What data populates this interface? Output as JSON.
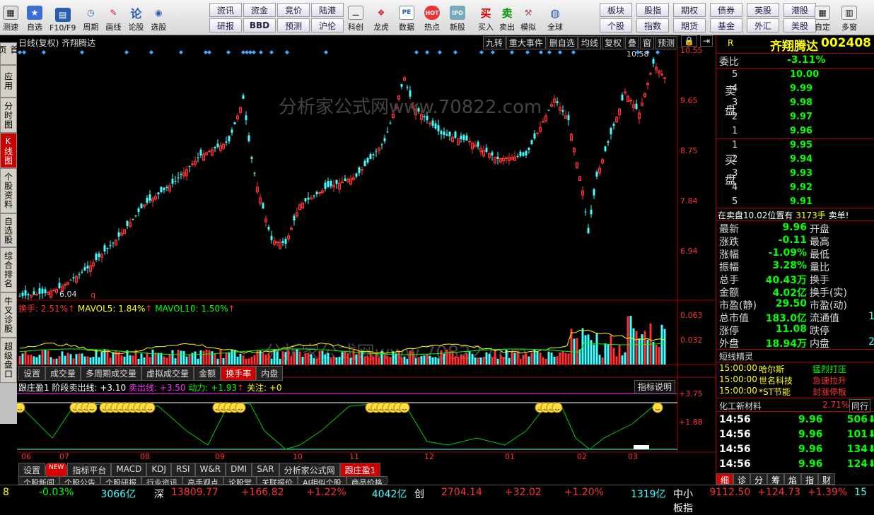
{
  "toolbar": {
    "buttons": [
      {
        "label": "测速",
        "icon": "speed-icon"
      },
      {
        "label": "自选",
        "icon": "star-icon"
      },
      {
        "label": "F10/F9",
        "icon": "f10-icon"
      },
      {
        "label": "周期",
        "icon": "clock-icon"
      },
      {
        "label": "画线",
        "icon": "pen-icon"
      },
      {
        "label": "论股",
        "icon": "discuss-icon"
      },
      {
        "label": "选股",
        "icon": "select-icon"
      }
    ],
    "grid1": [
      "资讯",
      "资金",
      "竞价",
      "陆港",
      "研报",
      "BBD",
      "预测",
      "沪伦"
    ],
    "buttons2": [
      {
        "label": "科创",
        "icon": "chart-icon"
      },
      {
        "label": "龙虎",
        "icon": "dragon-icon"
      },
      {
        "label": "数据",
        "icon": "pe-icon"
      },
      {
        "label": "热点",
        "icon": "hot-icon"
      },
      {
        "label": "新股",
        "icon": "ipo-icon"
      },
      {
        "label": "买入",
        "icon": "buy-icon"
      },
      {
        "label": "卖出",
        "icon": "sell-icon"
      },
      {
        "label": "模拟",
        "icon": "hammer-icon"
      },
      {
        "label": "全球",
        "icon": "globe-icon"
      }
    ],
    "grid2": [
      "板块",
      "股指",
      "期权",
      "债券",
      "英股",
      "港股",
      "个股",
      "指数",
      "期货",
      "基金",
      "外汇",
      "美股"
    ],
    "buttons3": [
      {
        "label": "自定",
        "icon": "custom-icon"
      },
      {
        "label": "多窗",
        "icon": "window-icon"
      }
    ],
    "buy_glyph": "买",
    "sell_glyph": "卖"
  },
  "left_nav": [
    {
      "label": "首页",
      "active": false
    },
    {
      "label": "应用",
      "active": false
    },
    {
      "label": "分时图",
      "active": false
    },
    {
      "label": "K线图",
      "active": true
    },
    {
      "label": "个股资料",
      "active": false
    },
    {
      "label": "自选股",
      "active": false
    },
    {
      "label": "综合排名",
      "active": false
    },
    {
      "label": "牛叉诊股",
      "active": false
    },
    {
      "label": "超级盘口",
      "active": false
    }
  ],
  "chart": {
    "title": "日线(复权) 齐翔腾达",
    "top_buttons": [
      "九转",
      "重大事件",
      "删自选",
      "均线",
      "复权",
      "叠",
      "窗",
      "预测"
    ],
    "watermark": "分析家公式网www.70822.com",
    "price_axis": [
      "10.55",
      "9.65",
      "8.75",
      "7.84",
      "6.94"
    ],
    "high_label": "10.58",
    "low_label": "6.04",
    "q_label": "q",
    "volume_header": {
      "a": "换手: 2.51%",
      "b": "MAVOL5: 1.84%",
      "c": "MAVOL10: 1.50%",
      "arrow": "↑"
    },
    "volume_axis": [
      "0.063",
      "0.032"
    ],
    "volume_tabs": [
      "设置",
      "成交量",
      "多周期成交量",
      "虚拟成交量",
      "金额",
      "换手率",
      "内盘"
    ],
    "volume_active_tab": "换手率",
    "indicator_header": {
      "name": "跟庄盈1",
      "a": "阶段卖出线: +3.10",
      "b": "卖出线: +3.50",
      "c": "动力: +1.93",
      "d": "关注: +0"
    },
    "indicator_btn": "指标说明",
    "indicator_axis": [
      "+3.75",
      "+1.88"
    ],
    "dates": [
      "06",
      "07",
      "08",
      "09",
      "10",
      "11",
      "12",
      "01",
      "02",
      "03"
    ],
    "indicator_tabs": [
      "设置",
      "NEW",
      "指标平台",
      "MACD",
      "KDJ",
      "RSI",
      "W&R",
      "DMI",
      "SAR",
      "分析家公式网",
      "跟庄盈1"
    ],
    "indicator_active_tab": "跟庄盈1",
    "news_tabs": [
      "个股新闻",
      "个股公告",
      "个股研报",
      "行业资讯",
      "高手观点",
      "论股堂",
      "关联报价",
      "AI相似个股",
      "商品价格"
    ]
  },
  "quote": {
    "r": "R",
    "name": "齐翔腾达",
    "code": "002408",
    "weibi_label": "委比",
    "weibi": "-3.11%",
    "sell_label": "卖盘",
    "buy_label": "买盘",
    "sells": [
      {
        "n": "5",
        "p": "10.00"
      },
      {
        "n": "4",
        "p": "9.99"
      },
      {
        "n": "3",
        "p": "9.98"
      },
      {
        "n": "2",
        "p": "9.97"
      },
      {
        "n": "1",
        "p": "9.96"
      }
    ],
    "buys": [
      {
        "n": "1",
        "p": "9.95"
      },
      {
        "n": "2",
        "p": "9.94"
      },
      {
        "n": "3",
        "p": "9.93"
      },
      {
        "n": "4",
        "p": "9.92"
      },
      {
        "n": "5",
        "p": "9.91"
      }
    ],
    "notice_a": "在卖盘10.02位置有",
    "notice_b": "3173手",
    "notice_c": "卖单!",
    "stats": [
      {
        "k": "最新",
        "v": "9.96",
        "k2": "开盘",
        "v2": ""
      },
      {
        "k": "涨跌",
        "v": "-0.11",
        "k2": "最高",
        "v2": ""
      },
      {
        "k": "涨幅",
        "v": "-1.09%",
        "k2": "最低",
        "v2": ""
      },
      {
        "k": "振幅",
        "v": "3.28%",
        "k2": "量比",
        "v2": ""
      },
      {
        "k": "总手",
        "v": "40.43万",
        "k2": "换手",
        "v2": ""
      },
      {
        "k": "金额",
        "v": "4.02亿",
        "k2": "换手(实)",
        "v2": ""
      },
      {
        "k": "市盈(静)",
        "v": "29.50",
        "k2": "市盈(动)",
        "v2": ""
      },
      {
        "k": "总市值",
        "v": "183.0亿",
        "k2": "流通值",
        "v2": "1"
      },
      {
        "k": "涨停",
        "v": "11.08",
        "k2": "跌停",
        "v2": ""
      },
      {
        "k": "外盘",
        "v": "18.94万",
        "k2": "内盘",
        "v2": "2"
      }
    ],
    "elf_title": "短线精灵",
    "elf": [
      {
        "t": "15:00:00",
        "n": "哈尔斯",
        "s": "猛烈打压"
      },
      {
        "t": "15:00:00",
        "n": "世名科技",
        "s": "急速拉升"
      },
      {
        "t": "15:00:00",
        "n": "*ST节能",
        "s": "封涨停板"
      }
    ],
    "industry": "化工新材料",
    "industry_pct": "2.71%",
    "industry_btn": "同行",
    "ticks": [
      {
        "t": "14:56",
        "p": "9.96",
        "v": "506"
      },
      {
        "t": "14:56",
        "p": "9.96",
        "v": "101"
      },
      {
        "t": "14:56",
        "p": "9.96",
        "v": "134"
      },
      {
        "t": "14:56",
        "p": "9.96",
        "v": "124"
      }
    ],
    "bottom_tabs": [
      "细",
      "诊",
      "分",
      "筹",
      "焰",
      "指",
      "财"
    ]
  },
  "status": {
    "items": [
      {
        "a": "8",
        "b": "-0.03%",
        "c": "3066亿"
      },
      {
        "a": "深",
        "b": "13809.77",
        "c": "+166.82",
        "d": "+1.22%",
        "e": "4042亿"
      },
      {
        "a": "创",
        "b": "2704.14",
        "c": "+32.02",
        "d": "+1.20%",
        "e": "1319亿"
      },
      {
        "a": "中小板指",
        "b": "9112.50",
        "c": "+124.73",
        "d": "+1.39%",
        "e": "15"
      }
    ]
  }
}
